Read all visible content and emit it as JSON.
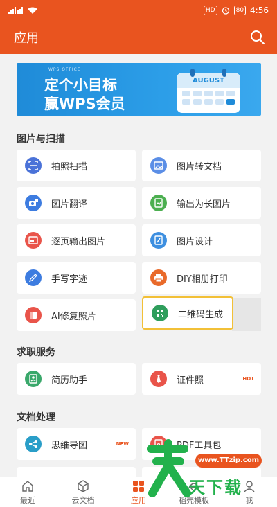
{
  "status": {
    "time": "4:56",
    "hd": "HD",
    "battery": "80"
  },
  "header": {
    "title": "应用",
    "search_icon": "search-icon"
  },
  "banner": {
    "small": "WPS OFFICE",
    "line1": "定个小目标",
    "line2": "赢WPS会员",
    "calendar_month": "AUGUST"
  },
  "sections": {
    "images": {
      "title": "图片与扫描"
    },
    "jobs": {
      "title": "求职服务"
    },
    "docs": {
      "title": "文档处理"
    }
  },
  "tools": {
    "scan": {
      "label": "拍照扫描",
      "icon": "scan-icon",
      "color": "#4a72d8"
    },
    "img2doc": {
      "label": "图片转文档",
      "icon": "image-doc-icon",
      "color": "#5b8ee6"
    },
    "translate": {
      "label": "图片翻译",
      "icon": "translate-icon",
      "color": "#3d7ce0"
    },
    "longimg": {
      "label": "输出为长图片",
      "icon": "long-image-icon",
      "color": "#4caf50"
    },
    "pageimg": {
      "label": "逐页输出图片",
      "icon": "page-image-icon",
      "color": "#e9544a"
    },
    "imgdesign": {
      "label": "图片设计",
      "icon": "design-icon",
      "color": "#3d8fe0"
    },
    "handwrite": {
      "label": "手写字迹",
      "icon": "pen-icon",
      "color": "#3d7ce0"
    },
    "album": {
      "label": "DIY相册打印",
      "icon": "printer-icon",
      "color": "#e96a2a"
    },
    "ai": {
      "label": "AI修复照片",
      "icon": "ai-repair-icon",
      "color": "#e9544a"
    },
    "qrcode": {
      "label": "二维码生成",
      "icon": "qrcode-icon",
      "color": "#2f9e5c"
    },
    "resume": {
      "label": "简历助手",
      "icon": "resume-icon",
      "color": "#3aa86b"
    },
    "idphoto": {
      "label": "证件照",
      "icon": "tie-icon",
      "color": "#e9544a",
      "badge": "HOT"
    },
    "mindmap": {
      "label": "思维导图",
      "icon": "mindmap-icon",
      "color": "#2a9ec8",
      "badge": "NEW"
    },
    "pdf": {
      "label": "PDF工具包",
      "icon": "pdf-icon",
      "color": "#e9544a"
    }
  },
  "nav": {
    "recent": "最近",
    "cloud": "云文档",
    "apps": "应用",
    "templates": "稻壳模板",
    "me": "我"
  },
  "watermark": {
    "url": "www.TTzip.com",
    "text": "天下载"
  }
}
